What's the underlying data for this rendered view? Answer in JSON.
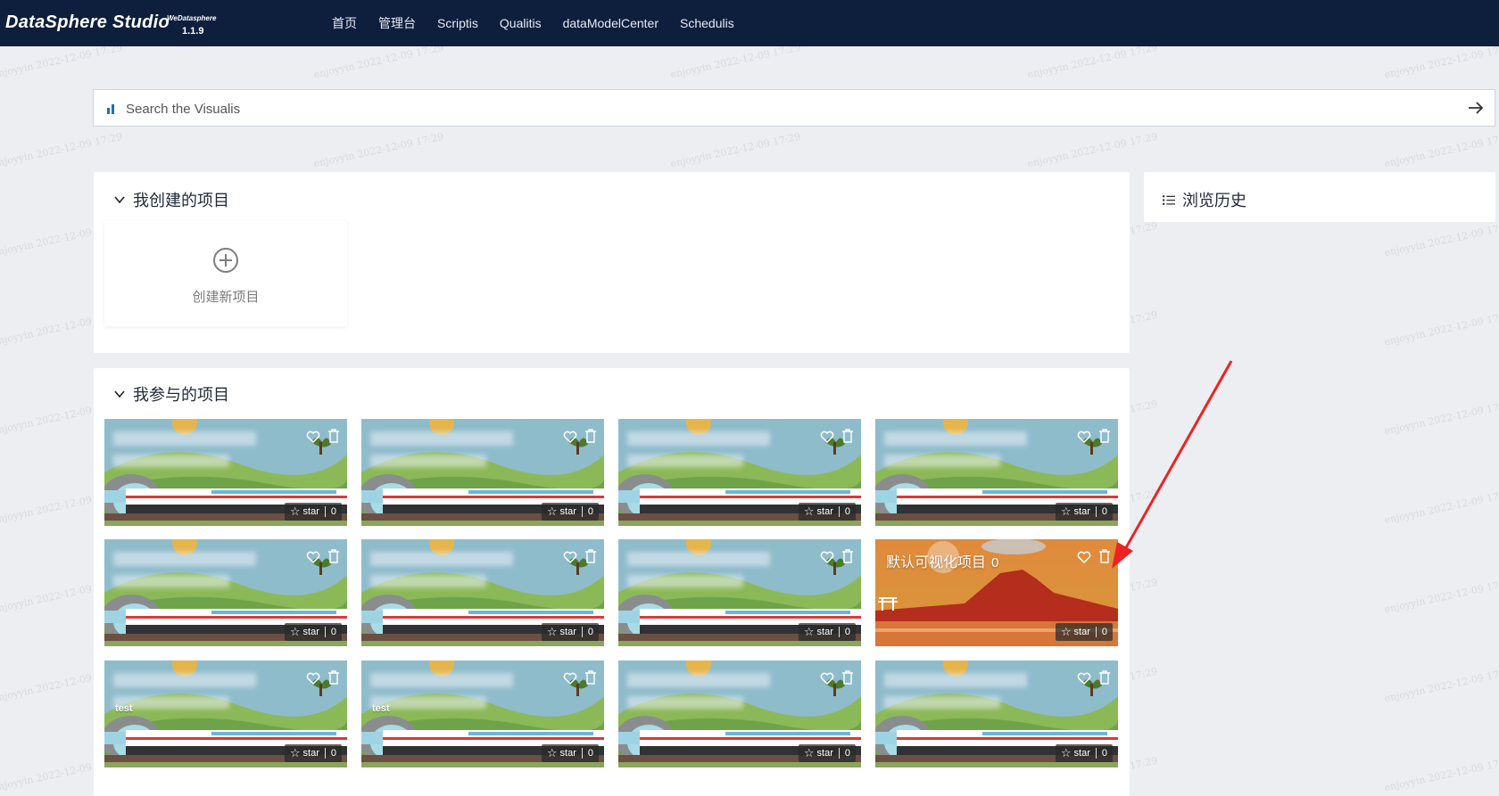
{
  "header": {
    "brand": "DataSphere Studio",
    "brand_sup": "WeDatasphere",
    "version": "1.1.9",
    "nav": [
      "首页",
      "管理台",
      "Scriptis",
      "Qualitis",
      "dataModelCenter",
      "Schedulis"
    ]
  },
  "search": {
    "placeholder": "Search the Visualis"
  },
  "my_created": {
    "title": "我创建的项目",
    "new_project_label": "创建新项目"
  },
  "history": {
    "title": "浏览历史"
  },
  "participated": {
    "title": "我参与的项目",
    "star_label": "star",
    "cards": [
      {
        "theme": "train",
        "tag": "",
        "title": "",
        "count": "0"
      },
      {
        "theme": "train",
        "tag": "",
        "title": "",
        "count": "0"
      },
      {
        "theme": "train",
        "tag": "",
        "title": "",
        "count": "0"
      },
      {
        "theme": "train",
        "tag": "",
        "title": "",
        "count": "0"
      },
      {
        "theme": "train",
        "tag": "",
        "title": "",
        "count": "0"
      },
      {
        "theme": "train",
        "tag": "",
        "title": "",
        "count": "0"
      },
      {
        "theme": "train",
        "tag": "",
        "title": "",
        "count": "0"
      },
      {
        "theme": "sunset",
        "tag": "",
        "title": "默认可视化项目",
        "title_count": "0",
        "count": "0"
      },
      {
        "theme": "train",
        "tag": "test",
        "title": "",
        "count": "0"
      },
      {
        "theme": "train",
        "tag": "test",
        "title": "",
        "count": "0"
      },
      {
        "theme": "train",
        "tag": "",
        "title": "",
        "count": "0"
      },
      {
        "theme": "train",
        "tag": "",
        "title": "",
        "count": "0"
      }
    ]
  },
  "watermark_text": "enjoyyin 2022-12-09 17:29",
  "colors": {
    "header_bg": "#0e1f3d",
    "page_bg": "#eceef2",
    "annotation_arrow": "#ee2222"
  }
}
